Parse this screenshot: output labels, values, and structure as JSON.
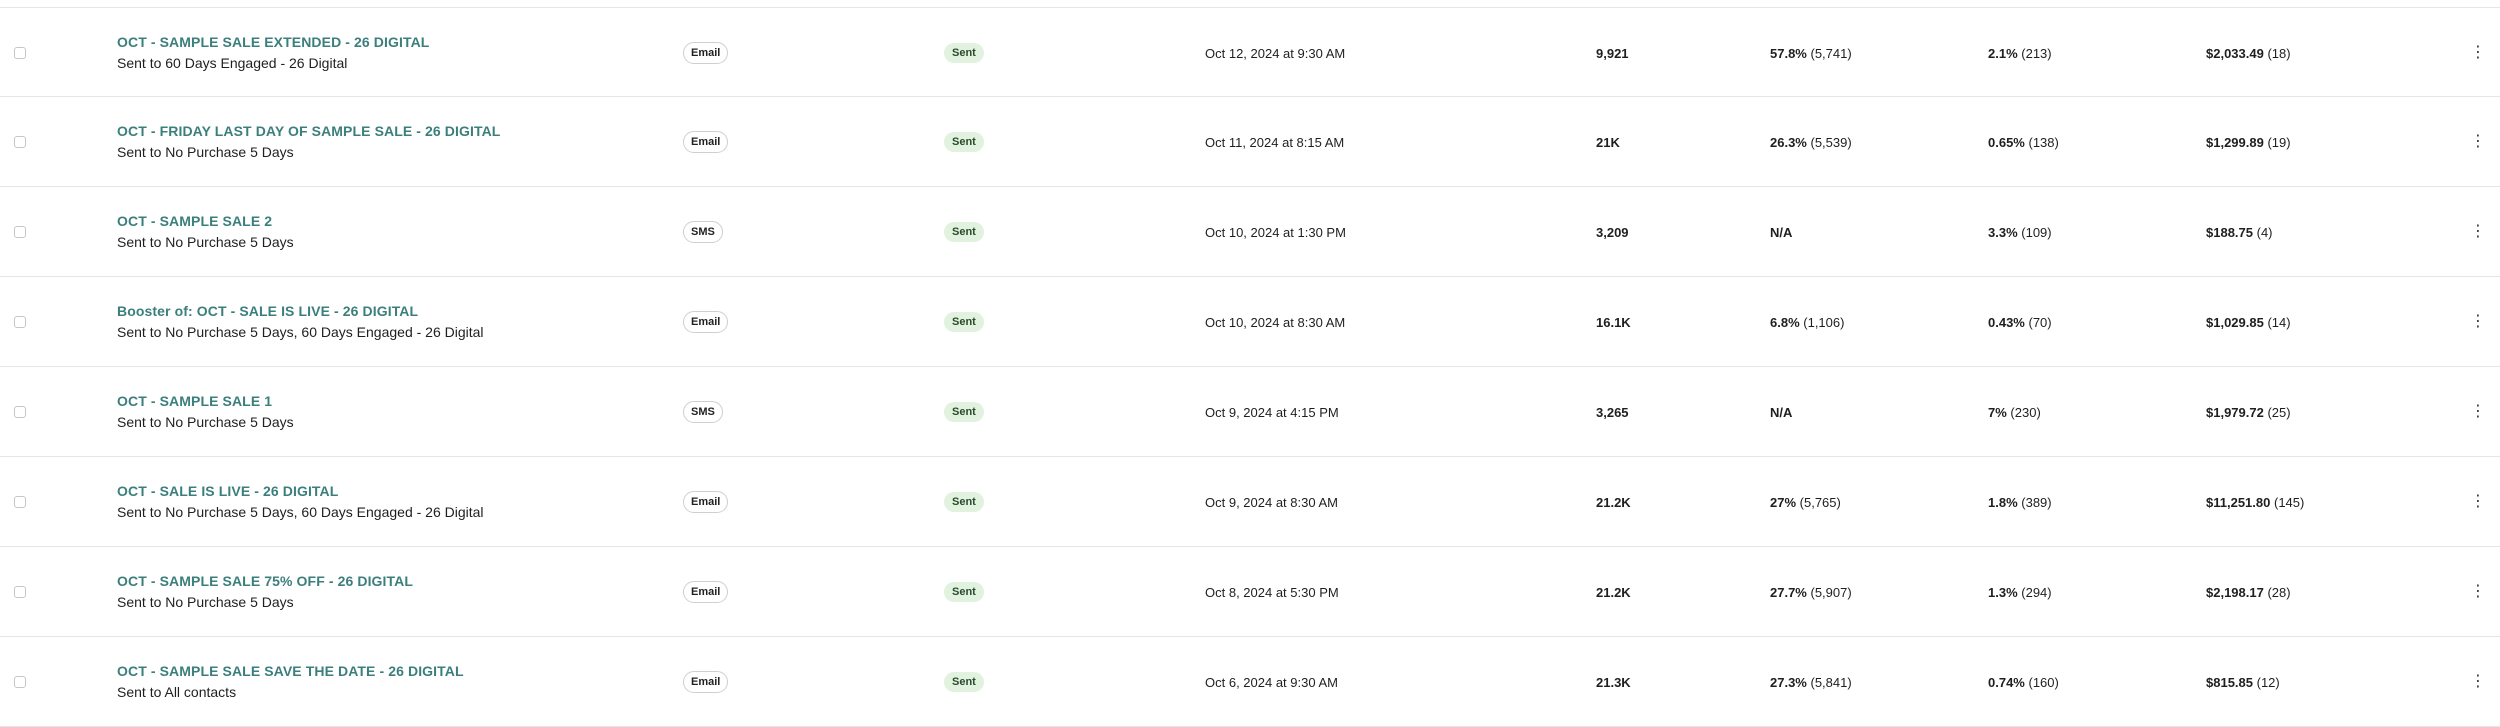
{
  "kebab_glyph": "⋮",
  "rows": [
    {
      "name": "OCT - SAMPLE SALE EXTENDED - 26 DIGITAL",
      "audience": "Sent to 60 Days Engaged - 26 Digital",
      "channel": "Email",
      "status": "Sent",
      "date": "Oct 12, 2024 at 9:30 AM",
      "recipients": "9,921",
      "open_pct": "57.8%",
      "open_count": "(5,741)",
      "click_pct": "2.1%",
      "click_count": "(213)",
      "revenue": "$2,033.49",
      "orders": "(18)"
    },
    {
      "name": "OCT - FRIDAY LAST DAY OF SAMPLE SALE - 26 DIGITAL",
      "audience": "Sent to No Purchase 5 Days",
      "channel": "Email",
      "status": "Sent",
      "date": "Oct 11, 2024 at 8:15 AM",
      "recipients": "21K",
      "open_pct": "26.3%",
      "open_count": "(5,539)",
      "click_pct": "0.65%",
      "click_count": "(138)",
      "revenue": "$1,299.89",
      "orders": "(19)"
    },
    {
      "name": "OCT - SAMPLE SALE 2",
      "audience": "Sent to No Purchase 5 Days",
      "channel": "SMS",
      "status": "Sent",
      "date": "Oct 10, 2024 at 1:30 PM",
      "recipients": "3,209",
      "open_pct": "N/A",
      "open_count": "",
      "click_pct": "3.3%",
      "click_count": "(109)",
      "revenue": "$188.75",
      "orders": "(4)"
    },
    {
      "name": "Booster of: OCT - SALE IS LIVE - 26 DIGITAL",
      "audience": "Sent to No Purchase 5 Days, 60 Days Engaged - 26 Digital",
      "channel": "Email",
      "status": "Sent",
      "date": "Oct 10, 2024 at 8:30 AM",
      "recipients": "16.1K",
      "open_pct": "6.8%",
      "open_count": "(1,106)",
      "click_pct": "0.43%",
      "click_count": "(70)",
      "revenue": "$1,029.85",
      "orders": "(14)"
    },
    {
      "name": "OCT - SAMPLE SALE 1",
      "audience": "Sent to No Purchase 5 Days",
      "channel": "SMS",
      "status": "Sent",
      "date": "Oct 9, 2024 at 4:15 PM",
      "recipients": "3,265",
      "open_pct": "N/A",
      "open_count": "",
      "click_pct": "7%",
      "click_count": "(230)",
      "revenue": "$1,979.72",
      "orders": "(25)"
    },
    {
      "name": "OCT - SALE IS LIVE - 26 DIGITAL",
      "audience": "Sent to No Purchase 5 Days, 60 Days Engaged - 26 Digital",
      "channel": "Email",
      "status": "Sent",
      "date": "Oct 9, 2024 at 8:30 AM",
      "recipients": "21.2K",
      "open_pct": "27%",
      "open_count": "(5,765)",
      "click_pct": "1.8%",
      "click_count": "(389)",
      "revenue": "$11,251.80",
      "orders": "(145)"
    },
    {
      "name": "OCT - SAMPLE SALE 75% OFF - 26 DIGITAL",
      "audience": "Sent to No Purchase 5 Days",
      "channel": "Email",
      "status": "Sent",
      "date": "Oct 8, 2024 at 5:30 PM",
      "recipients": "21.2K",
      "open_pct": "27.7%",
      "open_count": "(5,907)",
      "click_pct": "1.3%",
      "click_count": "(294)",
      "revenue": "$2,198.17",
      "orders": "(28)"
    },
    {
      "name": "OCT - SAMPLE SALE SAVE THE DATE - 26 DIGITAL",
      "audience": "Sent to All contacts",
      "channel": "Email",
      "status": "Sent",
      "date": "Oct 6, 2024 at 9:30 AM",
      "recipients": "21.3K",
      "open_pct": "27.3%",
      "open_count": "(5,841)",
      "click_pct": "0.74%",
      "click_count": "(160)",
      "revenue": "$815.85",
      "orders": "(12)"
    }
  ]
}
